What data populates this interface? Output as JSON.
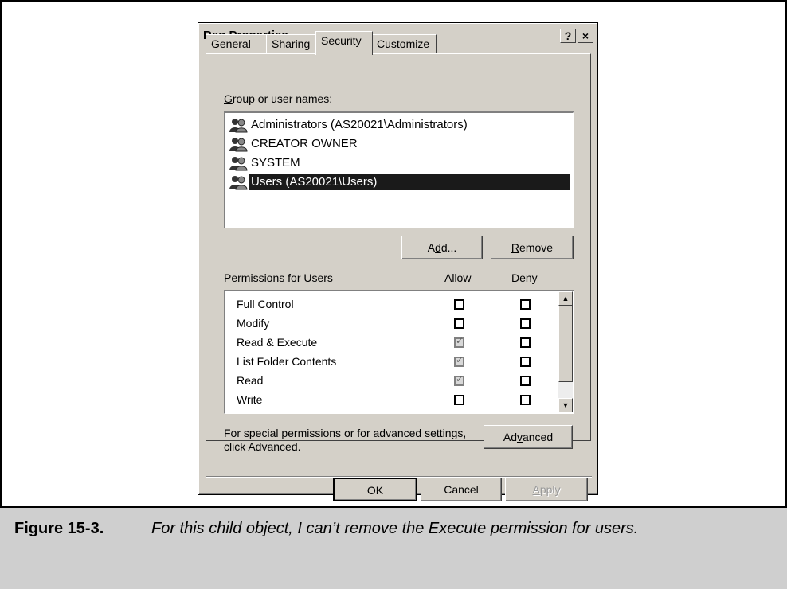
{
  "dialog": {
    "title": "Reg Properties",
    "help_button": "?",
    "close_button": "×",
    "tabs": [
      {
        "label": "General"
      },
      {
        "label": "Sharing"
      },
      {
        "label": "Security"
      },
      {
        "label": "Customize"
      }
    ],
    "active_tab": "Security",
    "group_label_key": "G",
    "group_label_rest": "roup or user names:",
    "groups": [
      {
        "name": "Administrators (AS20021\\Administrators)",
        "icon": "group-icon"
      },
      {
        "name": "CREATOR OWNER",
        "icon": "group-icon"
      },
      {
        "name": "SYSTEM",
        "icon": "group-icon"
      },
      {
        "name": "Users (AS20021\\Users)",
        "icon": "group-icon",
        "selected": true
      }
    ],
    "add_pre": "A",
    "add_key": "d",
    "add_post": "d...",
    "remove_key": "R",
    "remove_rest": "emove",
    "perm_label_key": "P",
    "perm_label_rest": "ermissions for Users",
    "col_allow": "Allow",
    "col_deny": "Deny",
    "permissions": [
      {
        "name": "Full Control",
        "allow": false,
        "deny": false
      },
      {
        "name": "Modify",
        "allow": false,
        "deny": false
      },
      {
        "name": "Read & Execute",
        "allow": true,
        "deny": false
      },
      {
        "name": "List Folder Contents",
        "allow": true,
        "deny": false
      },
      {
        "name": "Read",
        "allow": true,
        "deny": false
      },
      {
        "name": "Write",
        "allow": false,
        "deny": false
      }
    ],
    "advanced_text_line1": "For special permissions or for advanced settings,",
    "advanced_text_line2": "click Advanced.",
    "advanced_pre": "Ad",
    "advanced_key": "v",
    "advanced_post": "anced",
    "ok_label": "OK",
    "cancel_label": "Cancel",
    "apply_key": "A",
    "apply_rest": "pply"
  },
  "caption": {
    "label": "Figure 15-3.",
    "text": "For this child object, I can’t remove the Execute permission for users."
  }
}
